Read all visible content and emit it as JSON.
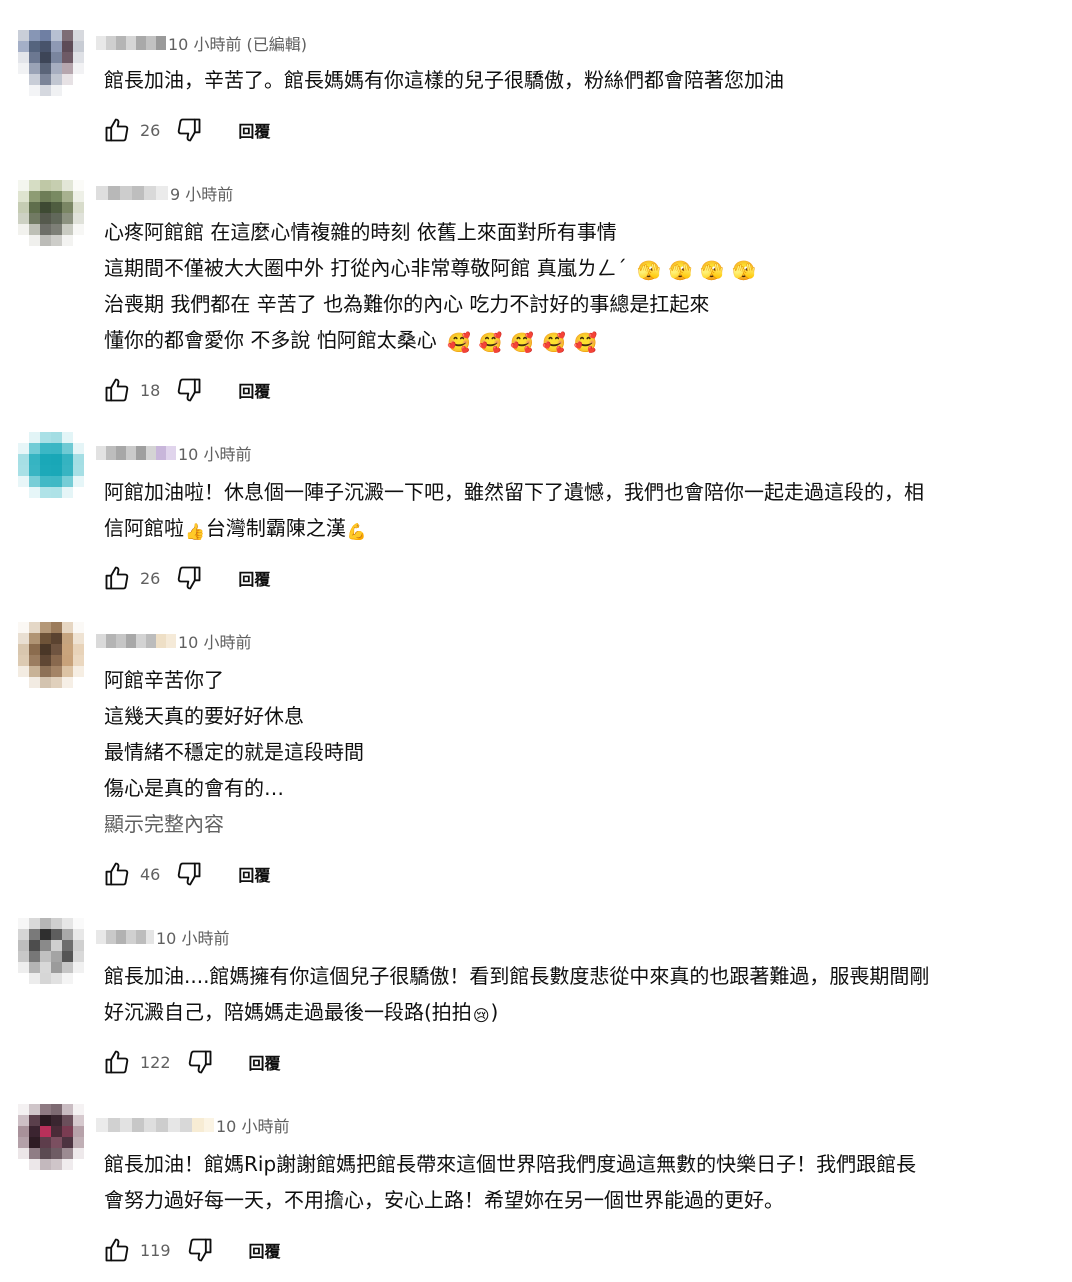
{
  "comments": [
    {
      "time": "10 小時前 (已編輯)",
      "lines": [
        "館長加油，辛苦了。館長媽媽有你這樣的兒子很驕傲，粉絲們都會陪著您加油"
      ],
      "likes": "26",
      "reply_label": "回覆"
    },
    {
      "time": "9 小時前",
      "lines": [
        "心疼阿館館 在這麼心情複雜的時刻 依舊上來面對所有事情",
        "這期間不僅被大大圈中外 打從內心非常尊敬阿館 真嵐ㄌㄥˊ",
        "治喪期 我們都在 辛苦了 也為難你的內心 吃力不討好的事總是扛起來",
        "懂你的都會愛你  不多說 怕阿館太桑心"
      ],
      "likes": "18",
      "reply_label": "回覆"
    },
    {
      "time": "10 小時前",
      "lines": [
        "阿館加油啦！休息個一陣子沉澱一下吧，雖然留下了遺憾，我們也會陪你一起走過這段的，相",
        "信阿館啦",
        "台灣制霸陳之漢"
      ],
      "likes": "26",
      "reply_label": "回覆"
    },
    {
      "time": "10 小時前",
      "lines": [
        "阿館辛苦你了",
        "這幾天真的要好好休息",
        "最情緒不穩定的就是這段時間",
        "傷心是真的會有的…"
      ],
      "show_more": "顯示完整內容",
      "likes": "46",
      "reply_label": "回覆"
    },
    {
      "time": "10 小時前",
      "lines": [
        "館長加油....館媽擁有你這個兒子很驕傲！看到館長數度悲從中來真的也跟著難過，服喪期間剛",
        "好沉澱自己，陪媽媽走過最後一段路(拍拍",
        ")"
      ],
      "likes": "122",
      "reply_label": "回覆"
    },
    {
      "time": "10 小時前",
      "lines": [
        "館長加油！館媽Rip謝謝館媽把館長帶來這個世界陪我們度過這無數的快樂日子！我們跟館長",
        "會努力過好每一天，不用擔心，安心上路！希望妳在另一個世界能過的更好。"
      ],
      "likes": "119",
      "reply_label": "回覆"
    }
  ],
  "emoji": {
    "hand_over_mouth": "🫣",
    "heart_hug": "🥰",
    "thumbs_up": "👍",
    "flexed_biceps": "💪",
    "crying_face": "😢"
  },
  "colors": {
    "text": "#0f0f0f",
    "meta": "#606060",
    "background": "#ffffff"
  }
}
